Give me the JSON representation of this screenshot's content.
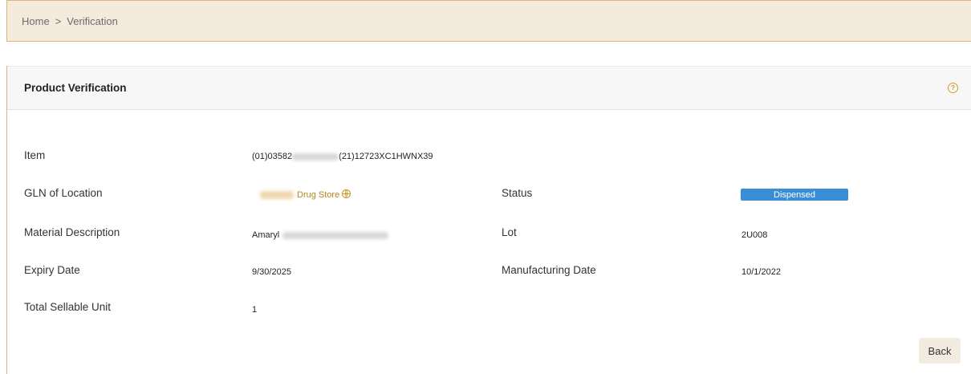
{
  "breadcrumb": {
    "home": "Home",
    "separator": ">",
    "current": "Verification"
  },
  "card": {
    "title": "Product Verification",
    "help_icon": "question-circle-icon"
  },
  "fields": {
    "item": {
      "label": "Item",
      "value_prefix": "(01)03582",
      "value_suffix": "(21)12723XC1HWNX39"
    },
    "gln": {
      "label": "GLN of Location",
      "value": "Drug Store",
      "icon": "globe-icon"
    },
    "material": {
      "label": "Material Description",
      "value": "Amaryl"
    },
    "expiry": {
      "label": "Expiry Date",
      "value": "9/30/2025"
    },
    "total_units": {
      "label": "Total Sellable Unit",
      "value": "1"
    },
    "status": {
      "label": "Status",
      "value": "Dispensed"
    },
    "lot": {
      "label": "Lot",
      "value": "2U008"
    },
    "mfg_date": {
      "label": "Manufacturing Date",
      "value": "10/1/2022"
    }
  },
  "actions": {
    "back_label": "Back"
  },
  "colors": {
    "breadcrumb_bg": "#f5ebdc",
    "accent_border": "#d9b57a",
    "status_badge": "#3a8ed8",
    "link_gold": "#b5851f"
  }
}
